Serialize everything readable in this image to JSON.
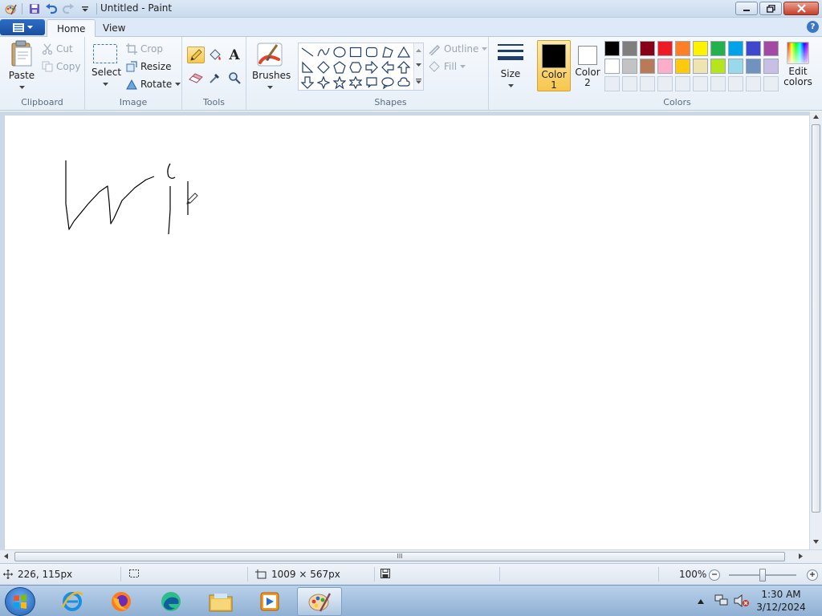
{
  "window": {
    "title": "Untitled - Paint"
  },
  "tabs": {
    "file_label": "",
    "home": "Home",
    "view": "View"
  },
  "help": {
    "label": "?"
  },
  "clipboard": {
    "paste": "Paste",
    "cut": "Cut",
    "copy": "Copy",
    "group": "Clipboard"
  },
  "image": {
    "select": "Select",
    "crop": "Crop",
    "resize": "Resize",
    "rotate": "Rotate",
    "group": "Image"
  },
  "tools": {
    "group": "Tools",
    "text_tool": "A"
  },
  "brushes": {
    "label": "Brushes"
  },
  "shapes": {
    "outline": "Outline",
    "fill": "Fill",
    "group": "Shapes"
  },
  "size": {
    "label": "Size"
  },
  "colors": {
    "color1_line1": "Color",
    "color1_line2": "1",
    "color2_line1": "Color",
    "color2_line2": "2",
    "edit_line1": "Edit",
    "edit_line2": "colors",
    "group": "Colors",
    "color1_value": "#000000",
    "color2_value": "#ffffff",
    "row1": [
      "#000000",
      "#7f7f7f",
      "#880015",
      "#ed1c24",
      "#ff7f27",
      "#fff200",
      "#22b14c",
      "#00a2e8",
      "#3f48cc",
      "#a349a4"
    ],
    "row2": [
      "#ffffff",
      "#c3c3c3",
      "#b97a57",
      "#ffaec9",
      "#ffc90e",
      "#efe4b0",
      "#b5e61d",
      "#99d9ea",
      "#7092be",
      "#c8bfe7"
    ]
  },
  "status": {
    "cursor_pos": "226, 115px",
    "canvas_size": "1009 × 567px",
    "zoom": "100%"
  },
  "scroll": {
    "grip": "III"
  },
  "taskbar": {
    "time": "1:30 AM",
    "date": "3/12/2024"
  }
}
